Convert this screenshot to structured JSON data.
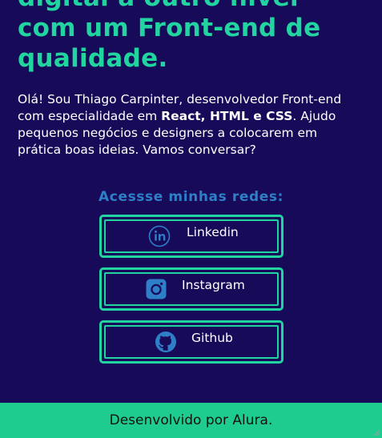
{
  "hero": {
    "headline_line1": "digital a outro nível",
    "headline_line2": "com um Front-end de",
    "headline_line3": "qualidade."
  },
  "intro": {
    "part1": "Olá! Sou Thiago Carpinter, desenvolvedor Front-end com especialidade em ",
    "highlight": "React, HTML e CSS",
    "part2": ". Ajudo pequenos negócios e designers a colocarem em prática boas ideias. Vamos conversar?"
  },
  "social": {
    "title": "Acessse minhas redes:",
    "links": [
      {
        "label": "Linkedin",
        "icon": "linkedin-icon"
      },
      {
        "label": "Instagram",
        "icon": "instagram-icon"
      },
      {
        "label": "Github",
        "icon": "github-icon"
      }
    ]
  },
  "footer": {
    "text": "Desenvolvido por Alura."
  },
  "colors": {
    "background": "#170a58",
    "accent": "#22d4a0",
    "social_title": "#2f7fc8",
    "footer_bg": "#1fcc8f"
  }
}
